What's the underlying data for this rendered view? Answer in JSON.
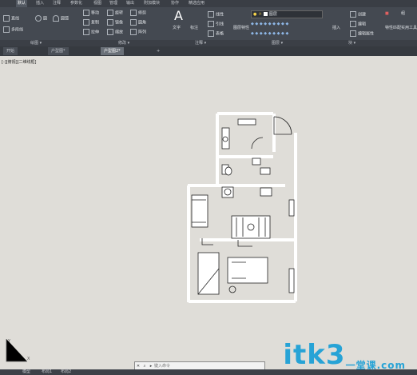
{
  "menu": {
    "tabs": [
      "默认",
      "插入",
      "注释",
      "参数化",
      "视图",
      "管理",
      "输出",
      "附加模块",
      "协作",
      "精选应用"
    ],
    "active": 0
  },
  "ribbon": {
    "draw": [
      "直线",
      "多段线",
      "圆",
      "圆弧"
    ],
    "modify": [
      "移动",
      "旋转",
      "修剪",
      "复制",
      "镜像",
      "圆角",
      "拉伸",
      "缩放",
      "阵列"
    ],
    "annotation": [
      "文字",
      "标注",
      "线性",
      "引线",
      "表格"
    ],
    "layers": [
      "图层特性",
      "图层"
    ],
    "block": [
      "插入",
      "创建",
      "编辑",
      "编辑属性"
    ],
    "properties": [
      "特性匹配"
    ],
    "groups": [
      "组"
    ],
    "utilities": [
      "实用工具"
    ]
  },
  "panels": [
    "绘图 ▾",
    "修改 ▾",
    "注释 ▾",
    "图层 ▾",
    "块 ▾"
  ],
  "doc_tabs": [
    {
      "label": "开始"
    },
    {
      "label": "户型图*"
    },
    {
      "label": "户型图2*",
      "active": true
    }
  ],
  "view_label": "[-][俯视][二维线框]",
  "command": {
    "placeholder": "键入命令"
  },
  "status": {
    "model": "模型",
    "layout1": "布局1",
    "layout2": "布局2"
  },
  "watermark": {
    "brand": "itk3",
    "sub": "一堂课",
    "domain": ".com"
  }
}
